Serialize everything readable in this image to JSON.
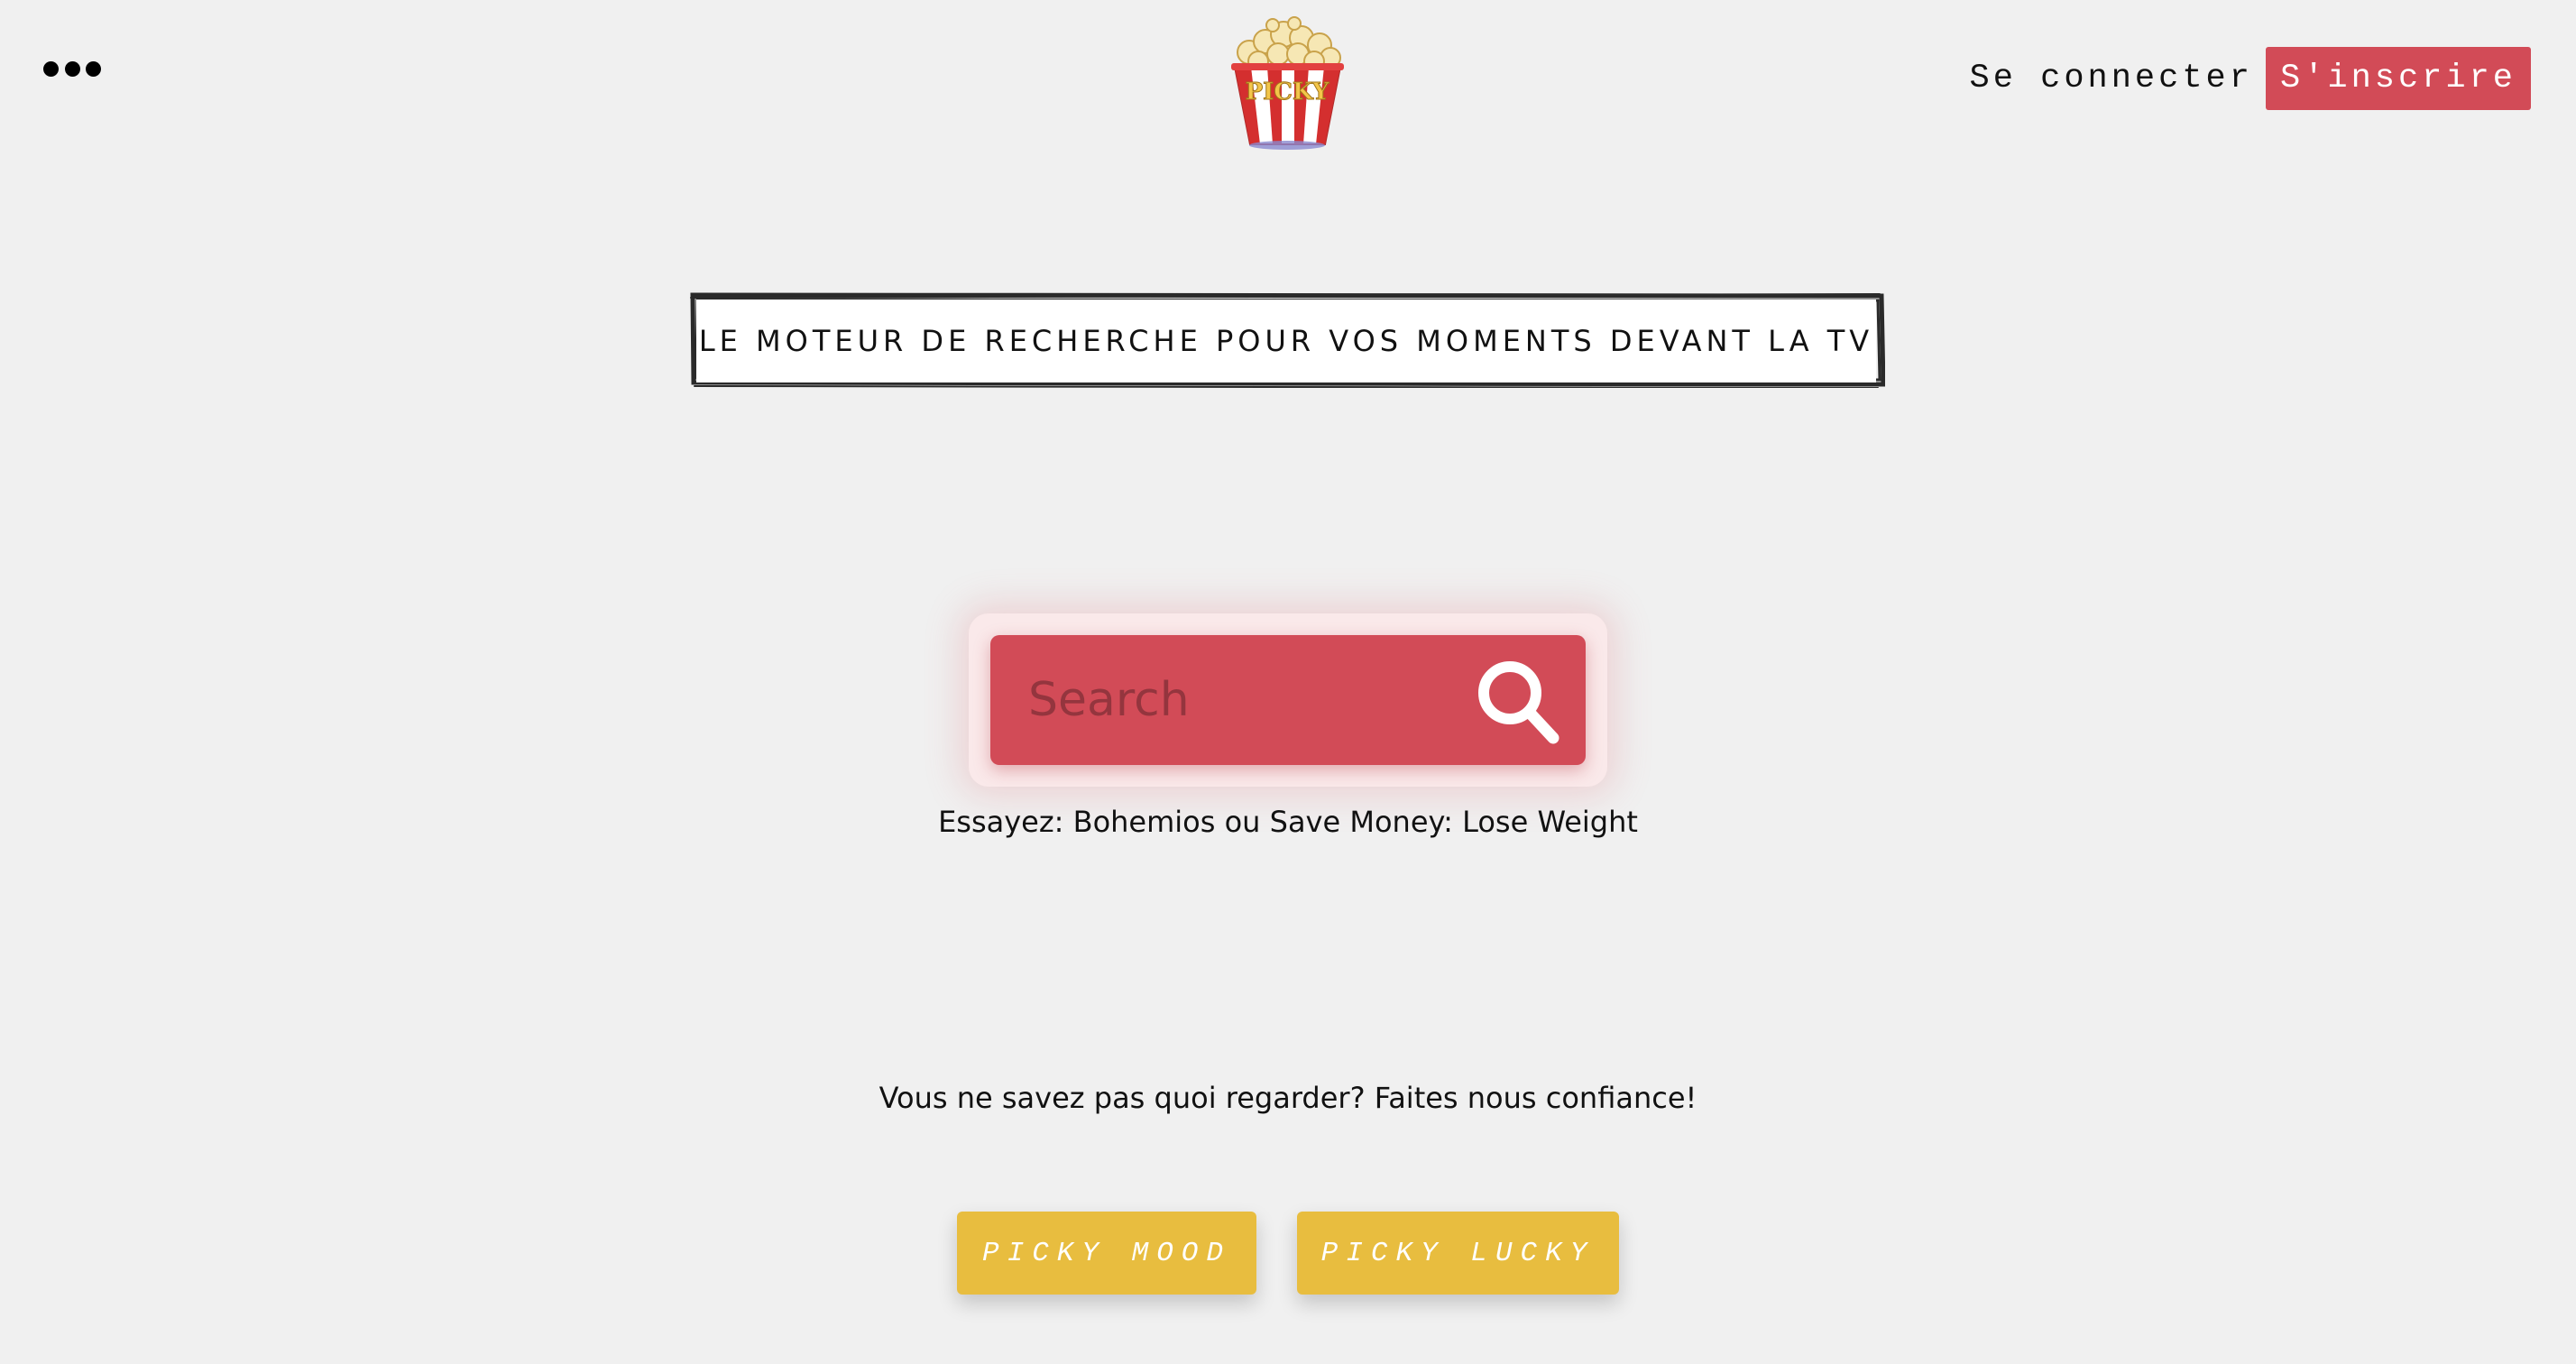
{
  "header": {
    "menu_icon": "more-horizontal-icon",
    "logo": {
      "text": "PICKY",
      "icon": "popcorn-bucket-icon"
    },
    "login_label": "Se connecter",
    "signup_label": "S'inscrire"
  },
  "tagline": "LE MOTEUR DE RECHERCHE POUR VOS MOMENTS DEVANT LA TV",
  "search": {
    "placeholder": "Search",
    "value": "",
    "icon": "search-icon"
  },
  "suggestion": "Essayez: Bohemios ou Save Money: Lose Weight",
  "prompt": "Vous ne savez pas quoi regarder? Faites nous confiance!",
  "actions": {
    "mood_label": "PICKY MOOD",
    "lucky_label": "PICKY LUCKY"
  },
  "colors": {
    "background": "#f0f0f0",
    "accent_red": "#d24b57",
    "accent_yellow": "#e8bd3f"
  }
}
